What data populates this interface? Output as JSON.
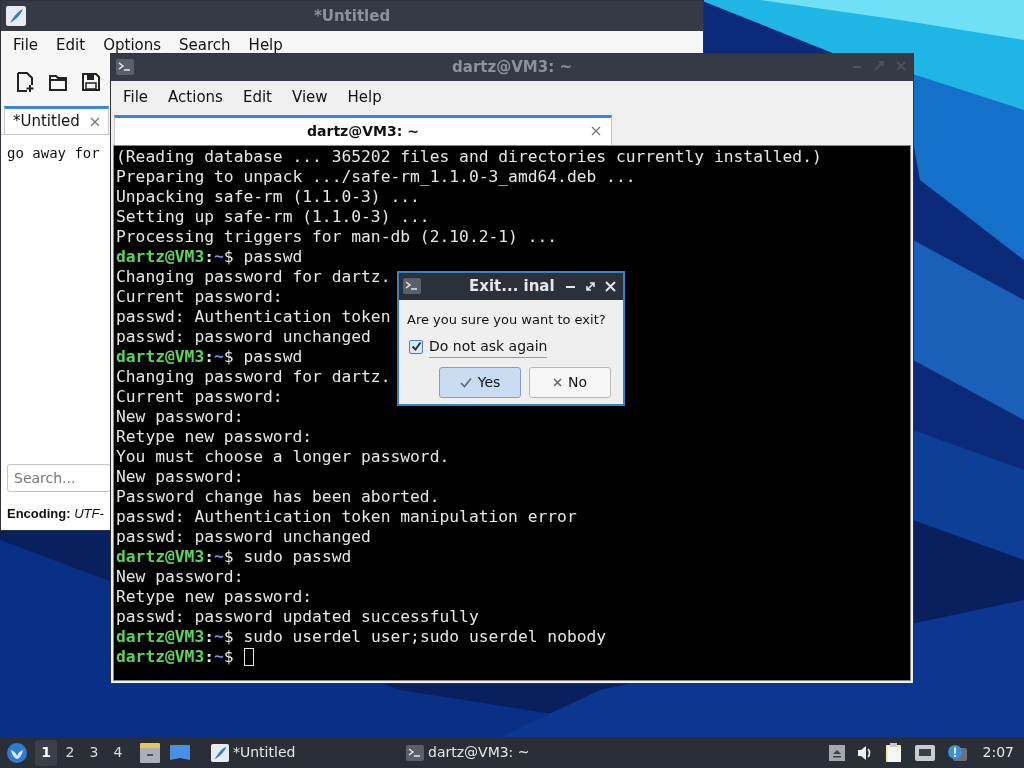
{
  "editor_window": {
    "title": "*Untitled",
    "menu": [
      "File",
      "Edit",
      "Options",
      "Search",
      "Help"
    ],
    "tabs": [
      {
        "label": "*Untitled",
        "selected": true
      }
    ],
    "content": "go away for",
    "search": {
      "placeholder": "Search..."
    },
    "status": "**Encoding:** *UTF-*"
  },
  "terminal_window": {
    "title": "dartz@VM3: ~",
    "menu": [
      "File",
      "Actions",
      "Edit",
      "View",
      "Help"
    ],
    "tabs": [
      {
        "label": "dartz@VM3: ~",
        "selected": true
      }
    ],
    "lines": [
      {
        "kind": "output",
        "text": "(Reading database ... 365202 files and directories currently installed.)"
      },
      {
        "kind": "output",
        "text": "Preparing to unpack .../safe-rm_1.1.0-3_amd64.deb ..."
      },
      {
        "kind": "output",
        "text": "Unpacking safe-rm (1.1.0-3) ..."
      },
      {
        "kind": "output",
        "text": "Setting up safe-rm (1.1.0-3) ..."
      },
      {
        "kind": "output",
        "text": "Processing triggers for man-db (2.10.2-1) ..."
      },
      {
        "kind": "prompt",
        "user": "dartz@VM3",
        "sep": ":",
        "path": "~",
        "symbol": "$",
        "command": "passwd"
      },
      {
        "kind": "output",
        "text": "Changing password for dartz."
      },
      {
        "kind": "output",
        "text": "Current password:"
      },
      {
        "kind": "output",
        "text": "passwd: Authentication token"
      },
      {
        "kind": "output",
        "text": "passwd: password unchanged"
      },
      {
        "kind": "prompt",
        "user": "dartz@VM3",
        "sep": ":",
        "path": "~",
        "symbol": "$",
        "command": "passwd"
      },
      {
        "kind": "output",
        "text": "Changing password for dartz."
      },
      {
        "kind": "output",
        "text": "Current password:"
      },
      {
        "kind": "output",
        "text": "New password:"
      },
      {
        "kind": "output",
        "text": "Retype new password:"
      },
      {
        "kind": "output",
        "text": "You must choose a longer password."
      },
      {
        "kind": "output",
        "text": "New password:"
      },
      {
        "kind": "output",
        "text": "Password change has been aborted."
      },
      {
        "kind": "output",
        "text": "passwd: Authentication token manipulation error"
      },
      {
        "kind": "output",
        "text": "passwd: password unchanged"
      },
      {
        "kind": "prompt",
        "user": "dartz@VM3",
        "sep": ":",
        "path": "~",
        "symbol": "$",
        "command": "sudo passwd"
      },
      {
        "kind": "output",
        "text": "New password:"
      },
      {
        "kind": "output",
        "text": "Retype new password:"
      },
      {
        "kind": "output",
        "text": "passwd: password updated successfully"
      },
      {
        "kind": "prompt",
        "user": "dartz@VM3",
        "sep": ":",
        "path": "~",
        "symbol": "$",
        "command": "sudo userdel user;sudo userdel nobody"
      },
      {
        "kind": "prompt",
        "user": "dartz@VM3",
        "sep": ":",
        "path": "~",
        "symbol": "$",
        "cursor": true
      }
    ]
  },
  "dialog": {
    "title": "Exit... inal",
    "message": "Are you sure you want to exit?",
    "checkbox": {
      "label": "Do not ask again",
      "checked": true
    },
    "buttons": [
      {
        "label": "Yes",
        "kind": "confirm",
        "selected": true
      },
      {
        "label": "No",
        "kind": "cancel",
        "selected": false
      }
    ]
  },
  "taskbar": {
    "workspaces": [
      {
        "label": "1",
        "selected": true
      },
      {
        "label": "2",
        "selected": false
      },
      {
        "label": "3",
        "selected": false
      },
      {
        "label": "4",
        "selected": false
      }
    ],
    "tasks": [
      {
        "label": "*Untitled",
        "kind": "editor"
      },
      {
        "label": "dartz@VM3: ~",
        "kind": "terminal"
      }
    ],
    "clock": "2:07"
  }
}
